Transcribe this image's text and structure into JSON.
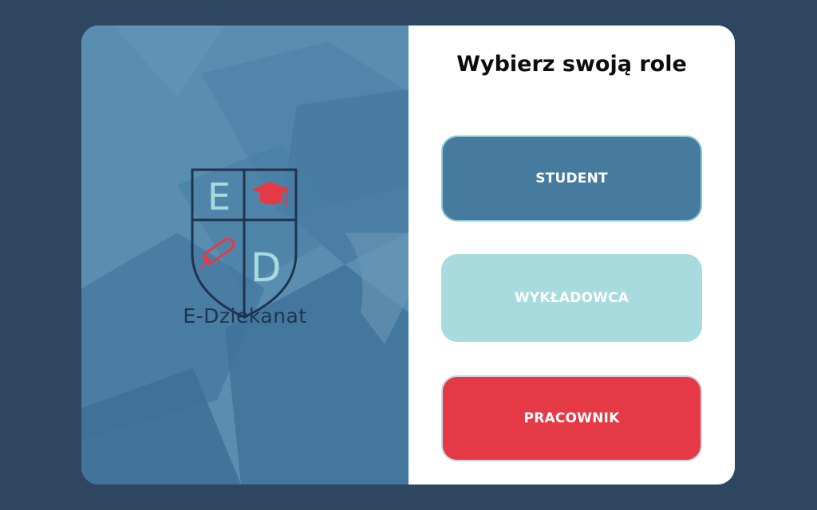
{
  "logo": {
    "letter_e": "E",
    "letter_d": "D",
    "name": "E-Dziekanat"
  },
  "main": {
    "title": "Wybierz swoją role",
    "buttons": {
      "student": "STUDENT",
      "lecturer": "WYKŁADOWCA",
      "worker": "PRACOWNIK"
    }
  },
  "colors": {
    "background": "#2e4660",
    "left_panel": "#5a8eb1",
    "student_button": "#467a9e",
    "lecturer_button": "#a7dbdd",
    "worker_button": "#e63946",
    "logo_accent": "#e63946",
    "logo_dark": "#1f3350"
  },
  "icons": [
    "graduation-cap-icon",
    "diploma-scroll-icon",
    "shield-crest-icon"
  ]
}
